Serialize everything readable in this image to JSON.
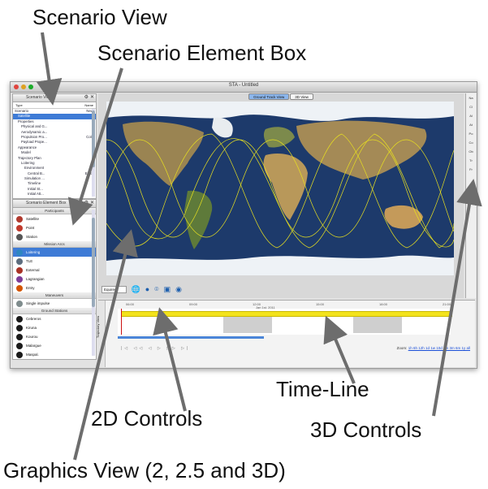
{
  "annotations": {
    "scenario_view": "Scenario View",
    "scenario_element_box": "Scenario Element Box",
    "time_line": "Time-Line",
    "controls_2d": "2D Controls",
    "controls_3d": "3D Controls",
    "graphics_view": "Graphics View (2, 2.5 and 3D)"
  },
  "window": {
    "title": "STA - Untitled",
    "view_tabs": [
      {
        "label": "Ground Track View",
        "active": true
      },
      {
        "label": "3D View",
        "active": false
      }
    ]
  },
  "scenario_view": {
    "header": "Scenario View",
    "columns": [
      "Type",
      "Name"
    ],
    "rows": [
      {
        "name": "Scenario",
        "value": "New"
      },
      {
        "name": "Satellite",
        "value": "",
        "selected": true
      },
      {
        "name": "Properties",
        "value": ""
      },
      {
        "name": "Physical and G...",
        "value": ""
      },
      {
        "name": "Aerodynamic a...",
        "value": ""
      },
      {
        "name": "Propulsion Pro...",
        "value": "Cold"
      },
      {
        "name": "Payload Prope...",
        "value": ""
      },
      {
        "name": "Appearance",
        "value": ""
      },
      {
        "name": "Model",
        "value": ""
      },
      {
        "name": "Trajectory Plan",
        "value": ""
      },
      {
        "name": "Loitering",
        "value": ""
      },
      {
        "name": "Environment",
        "value": ""
      },
      {
        "name": "Central B...",
        "value": "Earth"
      },
      {
        "name": "Simulation ...",
        "value": ""
      },
      {
        "name": "Timeline",
        "value": ""
      },
      {
        "name": "Initial St...",
        "value": ""
      },
      {
        "name": "Initial Att...",
        "value": ""
      },
      {
        "name": "Trajectory P...",
        "value": ""
      }
    ]
  },
  "element_box": {
    "header": "Scenario Element Box",
    "sections": [
      {
        "title": "Participants",
        "items": [
          {
            "label": "Satellite",
            "color": "#b03a2e"
          },
          {
            "label": "Point",
            "color": "#c0392b"
          },
          {
            "label": "Station",
            "color": "#555555"
          }
        ]
      },
      {
        "title": "Mission Arcs",
        "items": [
          {
            "label": "Loitering",
            "color": "#2e86c1",
            "selected": true
          },
          {
            "label": "TLE",
            "color": "#5d6d7e"
          },
          {
            "label": "External",
            "color": "#a93226"
          },
          {
            "label": "Lagrangian",
            "color": "#7d3c98"
          },
          {
            "label": "Entry",
            "color": "#d35400"
          }
        ]
      },
      {
        "title": "Maneuvers",
        "items": [
          {
            "label": "Single impulse",
            "color": "#7f8c8d"
          }
        ]
      },
      {
        "title": "Ground Stations",
        "items": [
          {
            "label": "Cebreros",
            "color": "#1a1a1a"
          },
          {
            "label": "Kiruna",
            "color": "#1a1a1a"
          },
          {
            "label": "Kourou",
            "color": "#1a1a1a"
          },
          {
            "label": "Malargue",
            "color": "#1a1a1a"
          },
          {
            "label": "Maspal.",
            "color": "#1a1a1a"
          },
          {
            "label": "Masalomas",
            "color": "#1a1a1a"
          }
        ]
      }
    ]
  },
  "graphics": {
    "projection_label": "Equirect",
    "map_colors": {
      "ocean": "#1d3a6b",
      "land": "#8a7a4a",
      "ice": "#eef2f6",
      "track": "#e8e020"
    },
    "toolbar_icons": [
      "globe-icon",
      "earth-icon",
      "satellite-icon",
      "camera-icon",
      "snapshot-icon"
    ]
  },
  "right_controls": {
    "items": [
      "Na",
      "Cl",
      "Al",
      "",
      "At",
      "Po",
      "Co",
      "Ob",
      "Tr",
      "Fr"
    ]
  },
  "timeline": {
    "side_label": "Trajectory View",
    "ruler": [
      "06:00",
      "09:00",
      "12:00",
      "15:00",
      "18:00",
      "21:00"
    ],
    "date": "Jan 1st, 2011",
    "controls": "|◁ ◁◁ ◁ ▷ ▷▷ ▷|",
    "zoom_label": "Zoom:",
    "zoom_value": "1h 6h 12h 1d 1w 10d 1m 3m 6m 1y all"
  }
}
